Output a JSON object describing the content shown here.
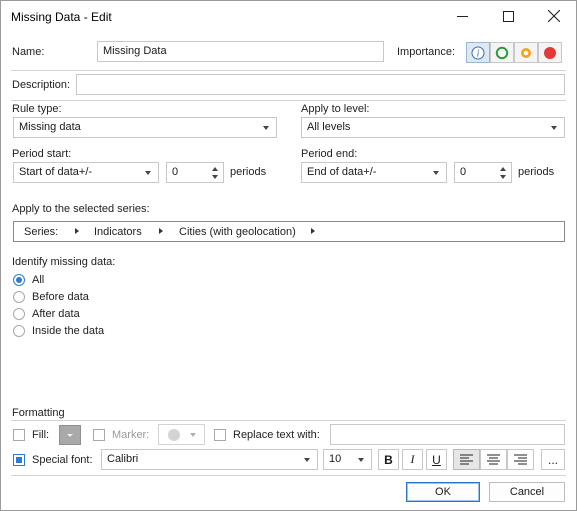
{
  "window": {
    "title": "Missing Data - Edit"
  },
  "name": {
    "label": "Name:",
    "value": "Missing Data"
  },
  "importance": {
    "label": "Importance:"
  },
  "description": {
    "label": "Description:",
    "value": ""
  },
  "rule_type": {
    "label": "Rule type:",
    "value": "Missing data"
  },
  "apply_level": {
    "label": "Apply to level:",
    "value": "All levels"
  },
  "period_start": {
    "label": "Period start:",
    "mode": "Start of data+/-",
    "count": "0",
    "unit": "periods"
  },
  "period_end": {
    "label": "Period end:",
    "mode": "End of data+/-",
    "count": "0",
    "unit": "periods"
  },
  "series": {
    "label": "Apply to the selected series:",
    "crumbs": [
      "Series:",
      "Indicators",
      "Cities (with geolocation)"
    ]
  },
  "identify": {
    "label": "Identify missing data:",
    "options": [
      "All",
      "Before data",
      "After data",
      "Inside the data"
    ],
    "selected": "All"
  },
  "formatting": {
    "label": "Formatting",
    "fill_label": "Fill:",
    "marker_label": "Marker:",
    "replace_label": "Replace text with:",
    "replace_value": "",
    "special_font_label": "Special font:",
    "font": "Calibri",
    "size": "10",
    "bold": "B",
    "italic": "I",
    "underline": "U",
    "more": "...",
    "fill_checked": false,
    "marker_checked": false,
    "replace_checked": false,
    "special_font_checked": true
  },
  "buttons": {
    "ok": "OK",
    "cancel": "Cancel"
  },
  "colors": {
    "accent": "#2d7bd4",
    "green": "#2e9b3b",
    "orange": "#f4a31b",
    "red": "#e23a3a"
  }
}
